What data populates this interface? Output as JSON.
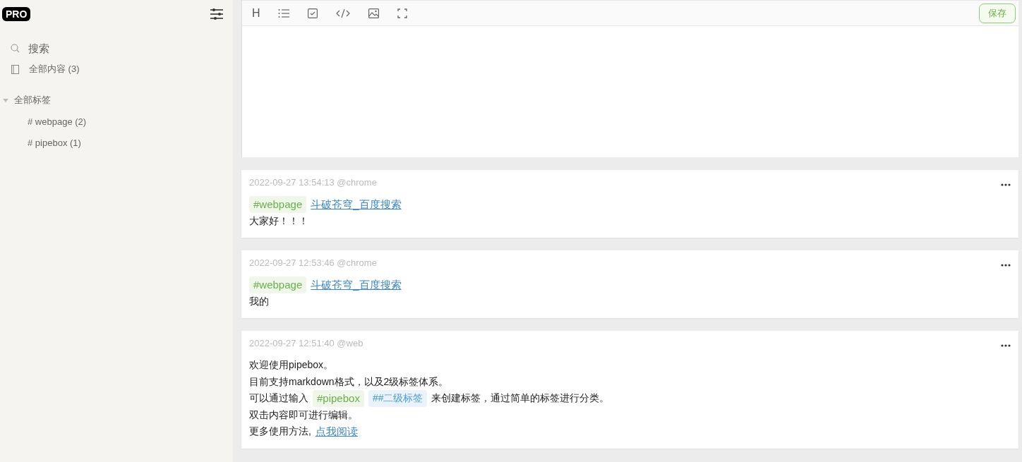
{
  "sidebar": {
    "logo": "PRO",
    "search": {
      "placeholder": "搜索"
    },
    "all_content": "全部内容 (3)",
    "tags": {
      "label": "全部标签",
      "expanded": true,
      "children": [
        {
          "label": "# webpage (2)"
        },
        {
          "label": "# pipebox (1)"
        }
      ]
    }
  },
  "editor": {
    "toolbar": [
      {
        "kind": "heading",
        "text": "H"
      },
      {
        "kind": "list"
      },
      {
        "kind": "checkbox"
      },
      {
        "kind": "code"
      },
      {
        "kind": "image"
      },
      {
        "kind": "fullscreen"
      }
    ],
    "save": "保存"
  },
  "notes": [
    {
      "meta": "2022-09-27 13:54:13 @chrome",
      "lines": [
        [
          {
            "kind": "tag",
            "text": "#webpage"
          },
          {
            "kind": "link",
            "text": "斗破苍穹_百度搜索"
          }
        ],
        [
          {
            "kind": "text",
            "text": "大家好！！！"
          }
        ]
      ]
    },
    {
      "meta": "2022-09-27 12:53:46 @chrome",
      "lines": [
        [
          {
            "kind": "tag",
            "text": "#webpage"
          },
          {
            "kind": "link",
            "text": "斗破苍穹_百度搜索"
          }
        ],
        [
          {
            "kind": "text",
            "text": "我的"
          }
        ]
      ]
    },
    {
      "meta": "2022-09-27 12:51:40 @web",
      "lines": [
        [
          {
            "kind": "text",
            "text": "欢迎使用pipebox。"
          }
        ],
        [
          {
            "kind": "text",
            "text": "目前支持markdown格式，以及2级标签体系。"
          }
        ],
        [
          {
            "kind": "text",
            "text": "可以通过输入"
          },
          {
            "kind": "tag",
            "text": "#pipebox"
          },
          {
            "kind": "subtag",
            "text": "##二级标签"
          },
          {
            "kind": "text",
            "text": "来创建标签，通过简单的标签进行分类。"
          }
        ],
        [
          {
            "kind": "text",
            "text": "双击内容即可进行编辑。"
          }
        ],
        [
          {
            "kind": "text",
            "text": "更多使用方法,"
          },
          {
            "kind": "link",
            "text": "点我阅读"
          }
        ]
      ]
    }
  ]
}
